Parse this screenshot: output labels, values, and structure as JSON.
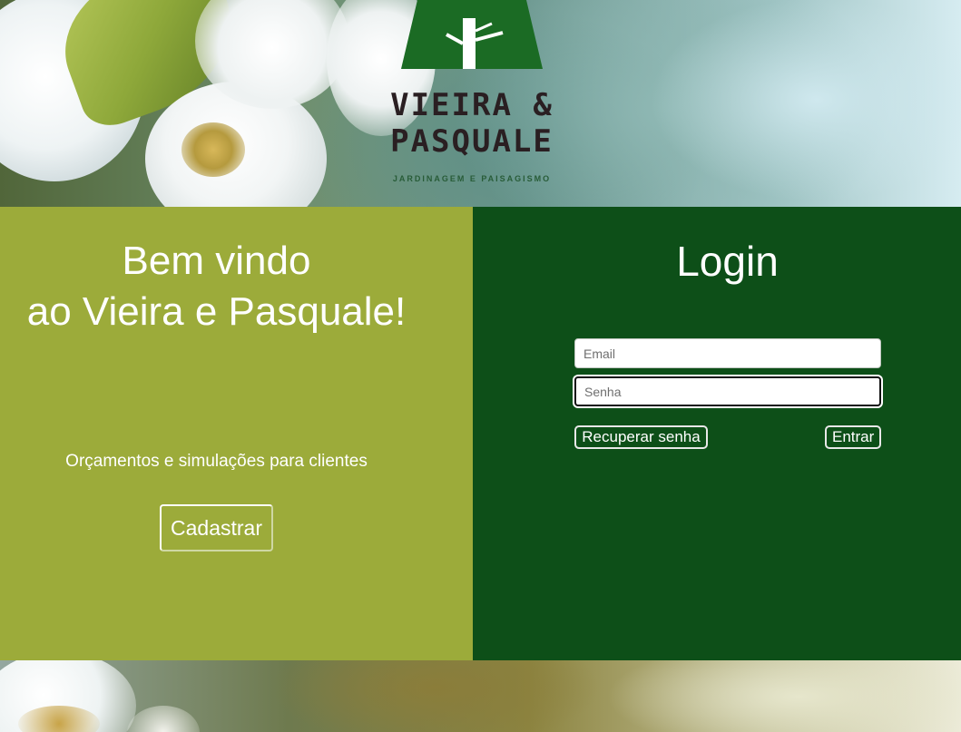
{
  "brand": {
    "name_line1": "VIEIRA &",
    "name_line2": "PASQUALE",
    "tagline": "JARDINAGEM E PAISAGISMO",
    "colors": {
      "dark_green": "#0d4f18",
      "olive": "#9cab3a",
      "logo_green": "#1b6b24"
    }
  },
  "welcome": {
    "line1": "Bem vindo",
    "line2": "ao Vieira e Pasquale!",
    "subtitle": "Orçamentos e simulações para clientes",
    "register_label": "Cadastrar"
  },
  "login": {
    "title": "Login",
    "email_placeholder": "Email",
    "password_placeholder": "Senha",
    "recover_label": "Recuperar senha",
    "submit_label": "Entrar"
  }
}
